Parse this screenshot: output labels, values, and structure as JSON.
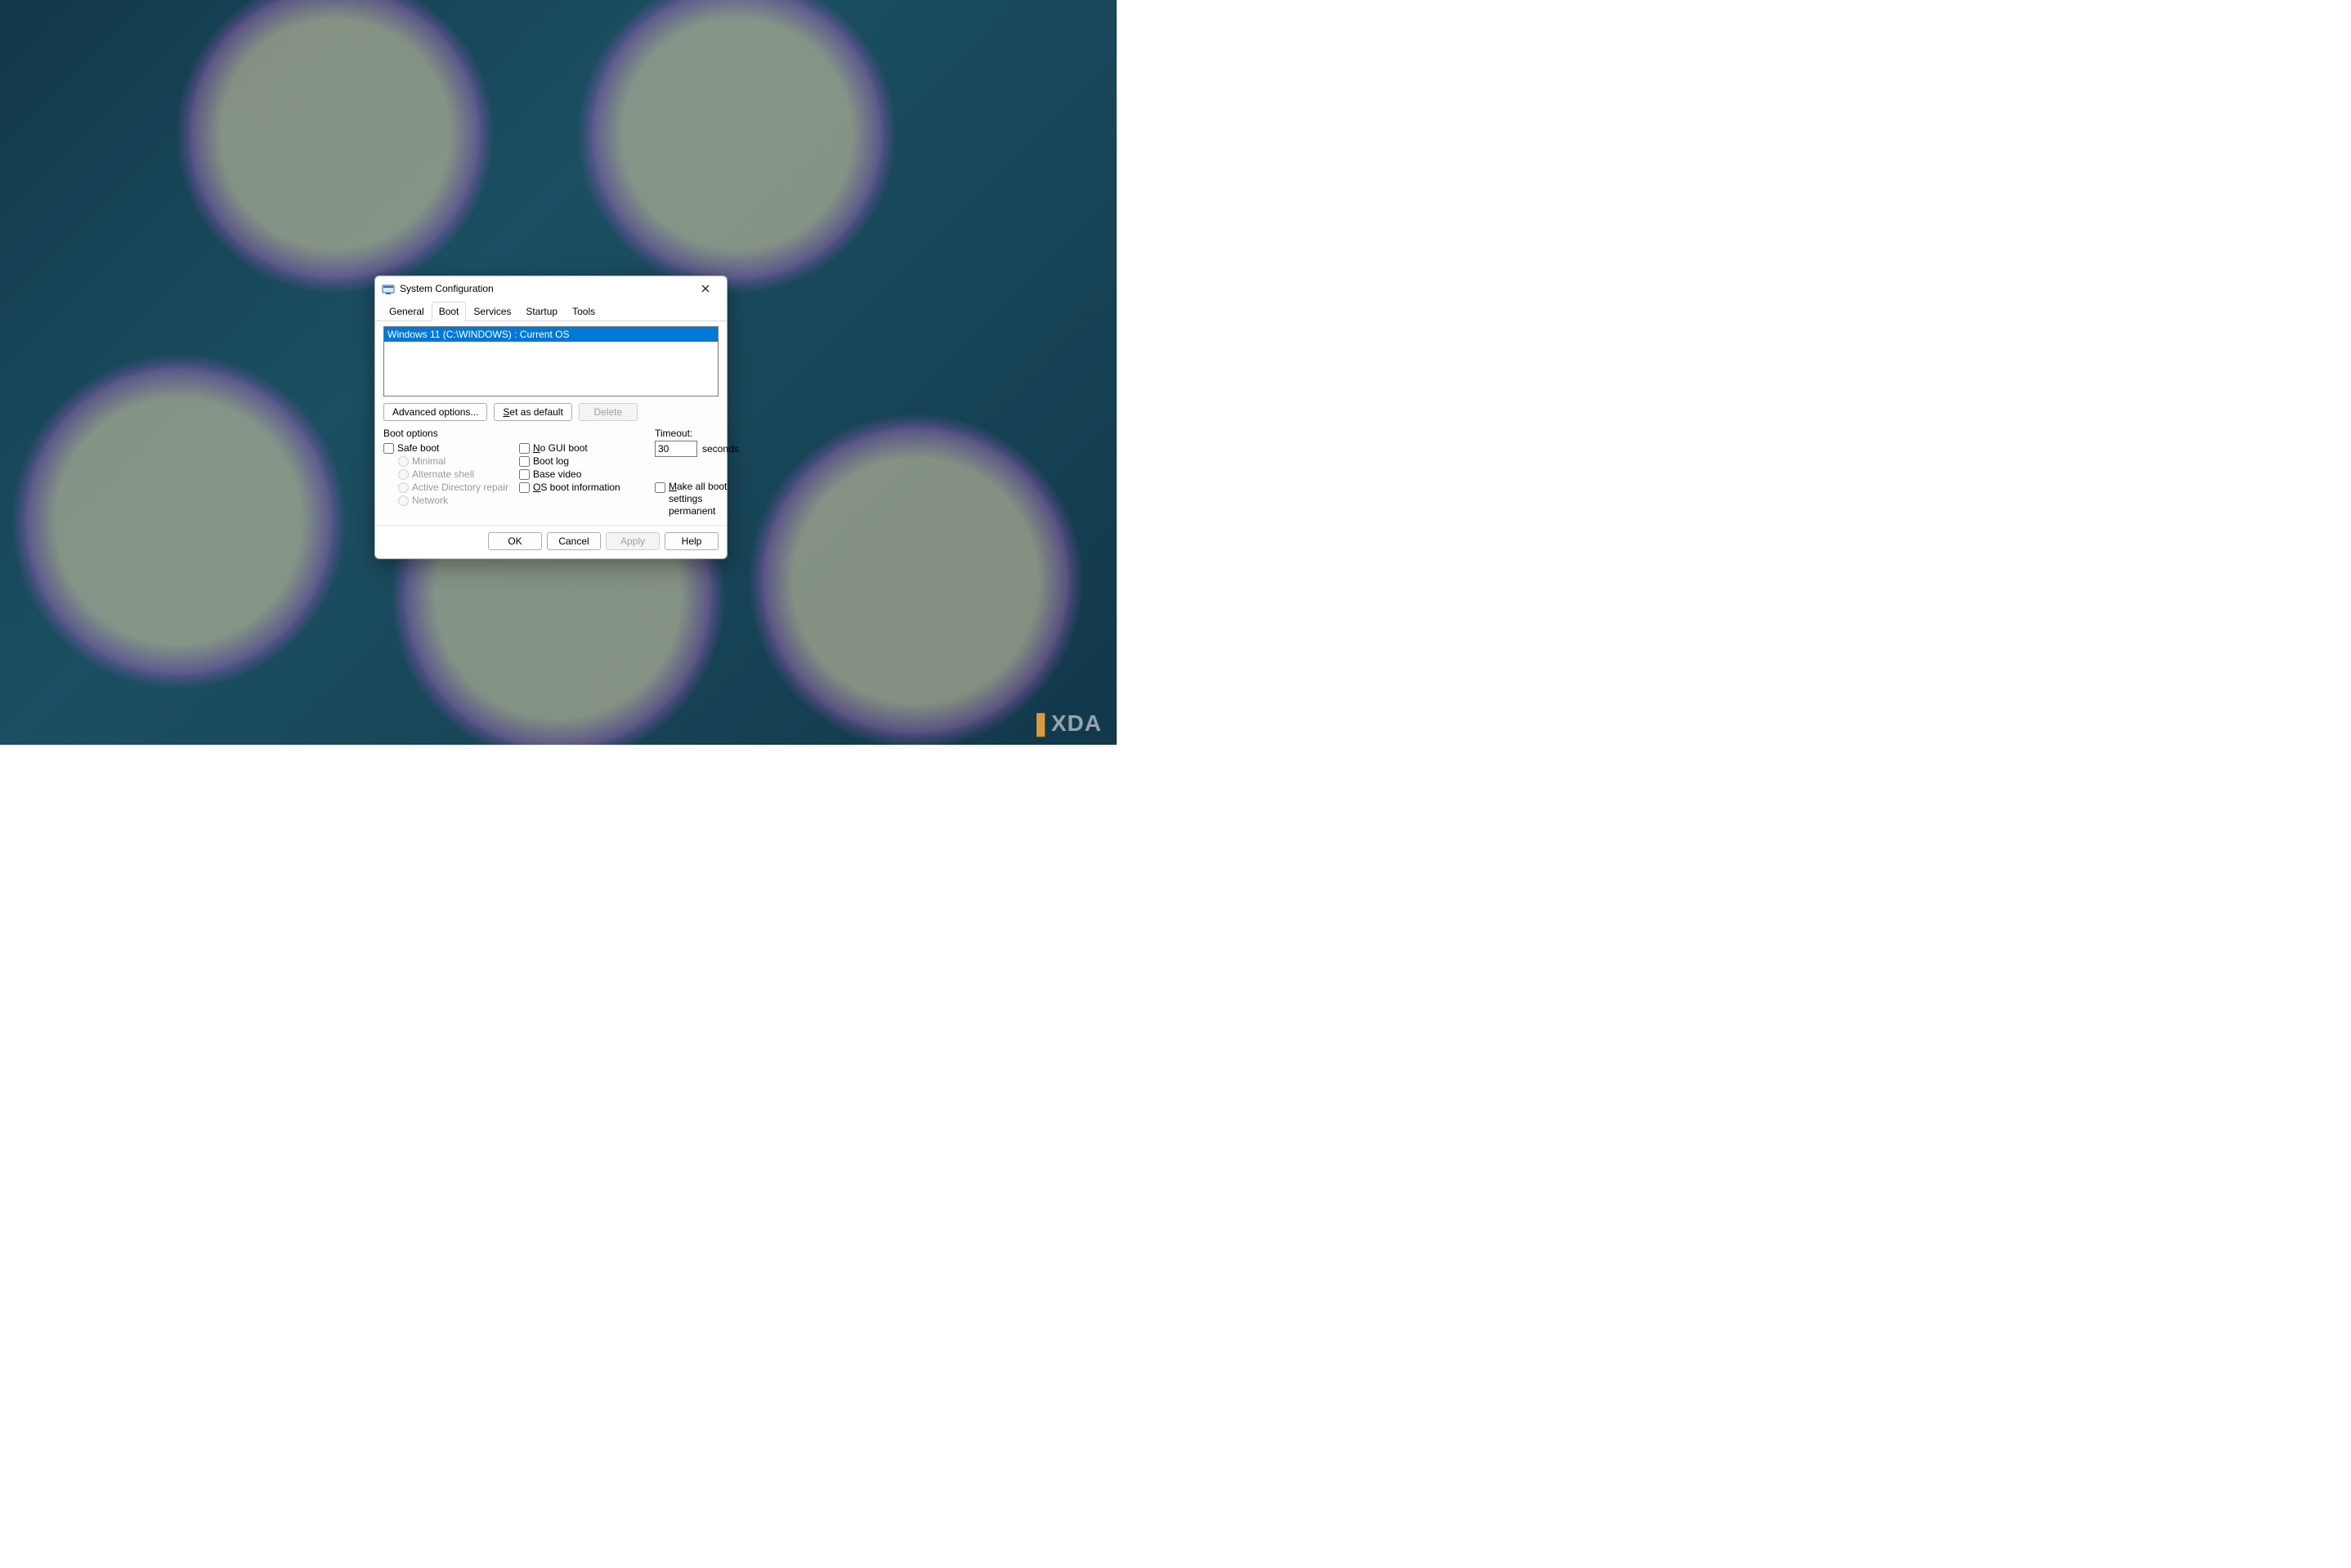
{
  "watermark": "XDA",
  "window": {
    "title": "System Configuration",
    "tabs": {
      "general": "General",
      "boot": "Boot",
      "services": "Services",
      "startup": "Startup",
      "tools": "Tools"
    },
    "os_entry": "Windows 11 (C:\\WINDOWS) : Current OS",
    "buttons": {
      "advanced": "Advanced options...",
      "set_default_prefix": "S",
      "set_default_rest": "et as default",
      "delete": "Delete"
    },
    "boot_options": {
      "title": "Boot options",
      "safe_boot": "Safe boot",
      "minimal": "Minimal",
      "alt_shell": "Alternate shell",
      "ad_repair": "Active Directory repair",
      "network": "Network",
      "no_gui_prefix": "N",
      "no_gui_rest": "o GUI boot",
      "boot_log": "Boot log",
      "base_video": "Base video",
      "os_boot_info_prefix": "O",
      "os_boot_info_rest": "S boot information"
    },
    "timeout": {
      "label": "Timeout:",
      "value": "30",
      "unit": "seconds"
    },
    "permanent_prefix": "M",
    "permanent_rest": "ake all boot settings permanent",
    "footer": {
      "ok": "OK",
      "cancel": "Cancel",
      "apply": "Apply",
      "help": "Help"
    }
  }
}
